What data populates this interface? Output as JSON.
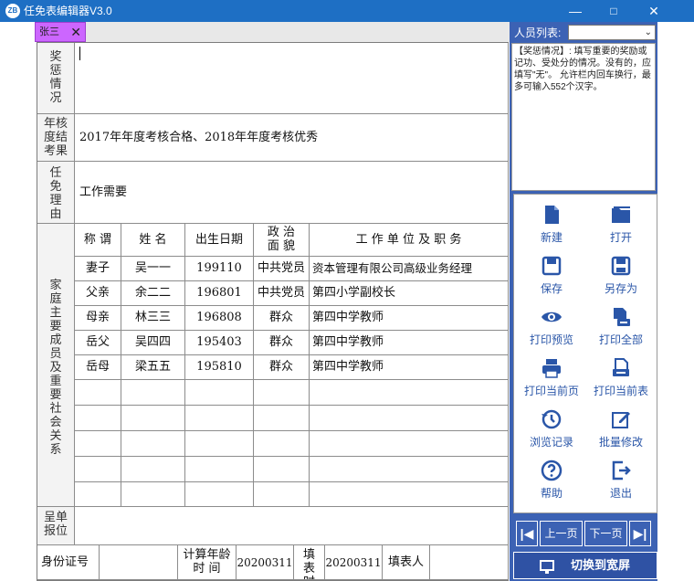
{
  "window": {
    "title": "任免表编辑器V3.0",
    "icon_text": "ZB",
    "minimize": "—",
    "maximize": "□",
    "close": "✕"
  },
  "tab": {
    "label": "张三",
    "close": "✕"
  },
  "form": {
    "awards_label": "奖惩情况",
    "awards_value": "",
    "assessment_label": "年核度结考果",
    "assessment_value": "2017年年度考核合格、2018年年度考核优秀",
    "reason_label": "任免理由",
    "reason_value": "工作需要",
    "family_label": "家庭主要成员及重要社会关系",
    "family_headers": [
      "称 谓",
      "姓 名",
      "出生日期",
      "政 治 面 貌",
      "工 作 单 位 及 职 务"
    ],
    "family_rows": [
      [
        "妻子",
        "吴一一",
        "199110",
        "中共党员",
        "资本管理有限公司高级业务经理"
      ],
      [
        "父亲",
        "余二二",
        "196801",
        "中共党员",
        "第四小学副校长"
      ],
      [
        "母亲",
        "林三三",
        "196808",
        "群众",
        "第四中学教师"
      ],
      [
        "岳父",
        "吴四四",
        "195403",
        "群众",
        "第四中学教师"
      ],
      [
        "岳母",
        "梁五五",
        "195810",
        "群众",
        "第四中学教师"
      ]
    ],
    "report_unit_label": "呈单报位",
    "id_label": "身份证号",
    "age_calc_label": "计算年龄时 间",
    "age_calc_value": "20200311",
    "fill_time_label": "填表时间",
    "fill_time_value": "20200311",
    "filler_label": "填表人"
  },
  "sidebar": {
    "person_list_label": "人员列表:",
    "hint_text": "【奖惩情况】: 填写重要的奖励或记功、受处分的情况。没有的，应填写\"无\"。 允许栏内回车换行，最多可输入552个汉字。",
    "tools": [
      {
        "name": "new",
        "label": "新建",
        "icon": "document-icon"
      },
      {
        "name": "open",
        "label": "打开",
        "icon": "folder-icon"
      },
      {
        "name": "save",
        "label": "保存",
        "icon": "save-icon"
      },
      {
        "name": "save-as",
        "label": "另存为",
        "icon": "save-as-icon"
      },
      {
        "name": "print-preview",
        "label": "打印预览",
        "icon": "eye-icon"
      },
      {
        "name": "print-all",
        "label": "打印全部",
        "icon": "print-all-icon"
      },
      {
        "name": "print-current-page",
        "label": "打印当前页",
        "icon": "printer-icon"
      },
      {
        "name": "print-current-form",
        "label": "打印当前表",
        "icon": "print-form-icon"
      },
      {
        "name": "history",
        "label": "浏览记录",
        "icon": "history-icon"
      },
      {
        "name": "batch-edit",
        "label": "批量修改",
        "icon": "edit-icon"
      },
      {
        "name": "help",
        "label": "帮助",
        "icon": "help-icon"
      },
      {
        "name": "exit",
        "label": "退出",
        "icon": "exit-icon"
      }
    ],
    "nav": {
      "first": "|◀",
      "prev": "上一页",
      "next": "下一页",
      "last": "▶|"
    },
    "switch_label": "切换到宽屏"
  },
  "colors": {
    "titlebar": "#1e6fc4",
    "panel": "#3c62b4",
    "tab": "#cc66ff",
    "icon": "#2a56a8"
  }
}
